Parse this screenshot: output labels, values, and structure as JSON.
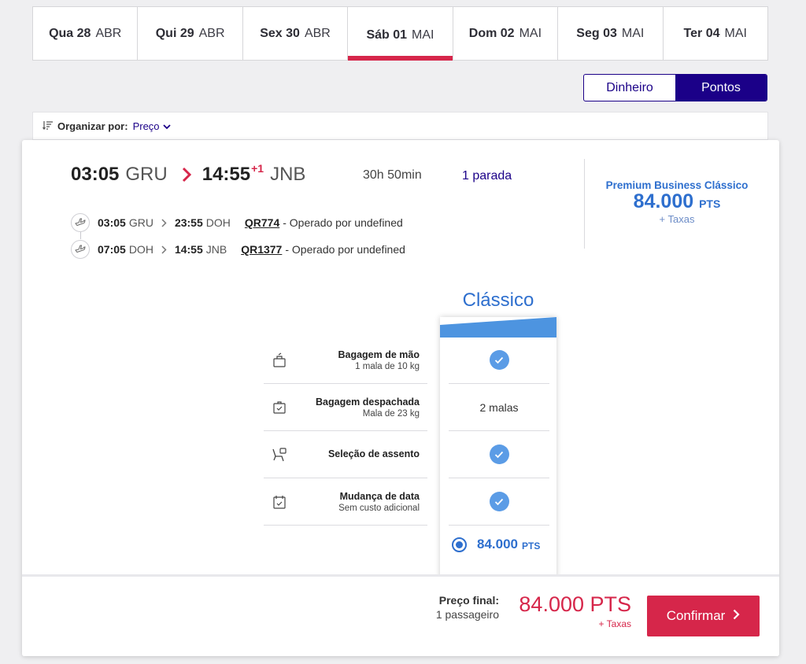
{
  "date_tabs": [
    {
      "day": "Qua 28",
      "month": "ABR"
    },
    {
      "day": "Qui 29",
      "month": "ABR"
    },
    {
      "day": "Sex 30",
      "month": "ABR"
    },
    {
      "day": "Sáb 01",
      "month": "MAI"
    },
    {
      "day": "Dom 02",
      "month": "MAI"
    },
    {
      "day": "Seg 03",
      "month": "MAI"
    },
    {
      "day": "Ter 04",
      "month": "MAI"
    }
  ],
  "selected_date_index": 3,
  "currency": {
    "money": "Dinheiro",
    "points": "Pontos",
    "selected": "points"
  },
  "sort": {
    "label": "Organizar por:",
    "value": "Preço"
  },
  "flight": {
    "departure_time": "03:05",
    "departure_airport": "GRU",
    "arrival_time": "14:55",
    "day_offset": "+1",
    "arrival_airport": "JNB",
    "duration": "30h 50min",
    "stops": "1 parada",
    "segments": [
      {
        "dep_time": "03:05",
        "dep_airport": "GRU",
        "arr_time": "23:55",
        "arr_airport": "DOH",
        "flight": "QR774",
        "operator": "- Operado por undefined"
      },
      {
        "dep_time": "07:05",
        "dep_airport": "DOH",
        "arr_time": "14:55",
        "arr_airport": "JNB",
        "flight": "QR1377",
        "operator": "- Operado por undefined"
      }
    ]
  },
  "fare_summary": {
    "name": "Premium Business Clássico",
    "price": "84.000",
    "unit": "PTS",
    "taxes": "+ Taxas"
  },
  "fare_family": {
    "title": "Clássico",
    "attributes": [
      {
        "icon": "hand-baggage-icon",
        "title": "Bagagem de mão",
        "subtitle": "1 mala de 10 kg",
        "value": "check"
      },
      {
        "icon": "checked-baggage-icon",
        "title": "Bagagem despachada",
        "subtitle": "Mala de 23 kg",
        "value": "2 malas"
      },
      {
        "icon": "seat-selection-icon",
        "title": "Seleção de assento",
        "subtitle": "",
        "value": "check"
      },
      {
        "icon": "calendar-change-icon",
        "title": "Mudança de data",
        "subtitle": "Sem custo adicional",
        "value": "check"
      }
    ],
    "price": "84.000",
    "unit": "PTS"
  },
  "footer": {
    "label": "Preço final:",
    "passengers": "1 passageiro",
    "price": "84.000 PTS",
    "taxes": "+ Taxas",
    "confirm": "Confirmar"
  },
  "colors": {
    "brand_red": "#d6264a",
    "brand_navy": "#1b0088",
    "fare_blue": "#2e6fce"
  }
}
